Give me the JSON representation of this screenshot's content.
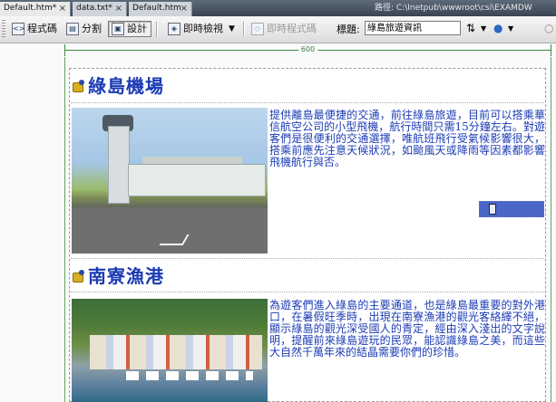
{
  "tabs": [
    {
      "label": "Default.htm*",
      "active": true
    },
    {
      "label": "data.txt*",
      "active": false
    },
    {
      "label": "Default.htm",
      "active": false
    }
  ],
  "tab_close_glyph": "×",
  "path_text": "路徑:  C:\\Inetpub\\wwwroot\\csi\\EXAMDW",
  "toolbar": {
    "code_label": "程式碼",
    "split_label": "分割",
    "design_label": "設計",
    "live_view_label": "即時檢視",
    "live_code_label": "即時程式碼",
    "title_label": "標題:",
    "title_value": "綠島旅遊資訊"
  },
  "ruler": {
    "width_label": "600"
  },
  "sections": [
    {
      "title": "綠島機場",
      "text": "提供離島最便捷的交通，前往綠島旅遊，目前可以搭乘華信航空公司的小型飛機，航行時間只需15分鐘左右。對遊客們是很便利的交通選擇，唯航班飛行受氣候影響很大，搭乘前應先注意天候狀況，如颱風天或降雨等因素都影響飛機航行與否。"
    },
    {
      "title": "南寮漁港",
      "text": "為遊客們進入綠島的主要通道，也是綠島最重要的對外港口，在暑假旺季時，出現在南寮漁港的觀光客絡繹不絕，顯示綠島的觀光深受國人的青定，經由深入淺出的文字說明，提醒前來綠島遊玩的民眾，能認識綠島之美，而這些大自然千萬年來的結晶需要你們的珍惜。"
    }
  ]
}
